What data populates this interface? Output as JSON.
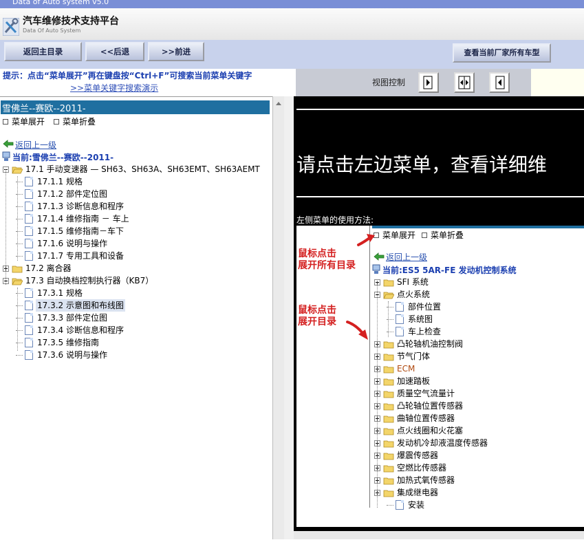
{
  "window": {
    "title": "Data of Auto system v5.0"
  },
  "header": {
    "title": "汽车维修技术支持平台",
    "subtitle": "Data Of Auto System"
  },
  "toolbar": {
    "home": "返回主目录",
    "back": "<<后退",
    "forward": ">>前进",
    "all_models": "查看当前厂家所有车型"
  },
  "tip": {
    "text": "提示：点击“菜单展开”再在键盘按“Ctrl+F”可搜索当前菜单关键字",
    "link": ">>菜单关键字搜索演示"
  },
  "view": {
    "label": "视图控制"
  },
  "left": {
    "car_title": "雪佛兰--赛欧--2011-",
    "expand": "菜单展开",
    "collapse": "菜单折叠",
    "back_link": "返回上一级",
    "current": "当前:雪佛兰--赛欧--2011-",
    "tree": [
      {
        "label": "17.1 手动变速器 — SH63、SH63A、SH63EMT、SH63AEMT",
        "kind": "folder-open"
      },
      {
        "label": "17.1.1 规格",
        "kind": "doc"
      },
      {
        "label": "17.1.2 部件定位图",
        "kind": "doc"
      },
      {
        "label": "17.1.3 诊断信息和程序",
        "kind": "doc"
      },
      {
        "label": "17.1.4 维修指南 － 车上",
        "kind": "doc"
      },
      {
        "label": "17.1.5 维修指南－车下",
        "kind": "doc"
      },
      {
        "label": "17.1.6 说明与操作",
        "kind": "doc"
      },
      {
        "label": "17.1.7 专用工具和设备",
        "kind": "doc"
      },
      {
        "label": "17.2 离合器",
        "kind": "folder-closed"
      },
      {
        "label": "17.3 自动换档控制执行器（KB7）",
        "kind": "folder-open"
      },
      {
        "label": "17.3.1 规格",
        "kind": "doc"
      },
      {
        "label": "17.3.2 示意图和布线图",
        "kind": "doc",
        "selected": true
      },
      {
        "label": "17.3.3 部件定位图",
        "kind": "doc"
      },
      {
        "label": "17.3.4 诊断信息和程序",
        "kind": "doc"
      },
      {
        "label": "17.3.5 维修指南",
        "kind": "doc"
      },
      {
        "label": "17.3.6 说明与操作",
        "kind": "doc"
      }
    ]
  },
  "right": {
    "prompt": "请点击左边菜单，查看详细维",
    "howto": "左侧菜单的使用方法:",
    "demo": {
      "expand": "菜单展开",
      "collapse": "菜单折叠",
      "back_link": "返回上一级",
      "current": "当前:ES5 5AR-FE 发动机控制系统",
      "note1": [
        "鼠标点击",
        "展开所有目录"
      ],
      "note2": [
        "鼠标点击",
        "展开目录"
      ],
      "tree": [
        {
          "label": "SFI 系统",
          "kind": "folder-closed"
        },
        {
          "label": "点火系统",
          "kind": "folder-open"
        },
        {
          "label": "部件位置",
          "kind": "doc"
        },
        {
          "label": "系统图",
          "kind": "doc"
        },
        {
          "label": "车上检查",
          "kind": "doc"
        },
        {
          "label": "凸轮轴机油控制阀",
          "kind": "folder-closed"
        },
        {
          "label": "节气门体",
          "kind": "folder-closed"
        },
        {
          "label": "ECM",
          "kind": "folder-closed",
          "color": "#b04a10"
        },
        {
          "label": "加速踏板",
          "kind": "folder-closed"
        },
        {
          "label": "质量空气流量计",
          "kind": "folder-closed"
        },
        {
          "label": "凸轮轴位置传感器",
          "kind": "folder-closed"
        },
        {
          "label": "曲轴位置传感器",
          "kind": "folder-closed"
        },
        {
          "label": "点火线圈和火花塞",
          "kind": "folder-closed"
        },
        {
          "label": "发动机冷却液温度传感器",
          "kind": "folder-closed"
        },
        {
          "label": "爆震传感器",
          "kind": "folder-closed"
        },
        {
          "label": "空燃比传感器",
          "kind": "folder-closed"
        },
        {
          "label": "加热式氧传感器",
          "kind": "folder-closed"
        },
        {
          "label": "集成继电器",
          "kind": "folder-closed"
        },
        {
          "label": "安装",
          "kind": "doc"
        }
      ]
    }
  },
  "colors": {
    "accent": "#1f6fa0",
    "tip": "#1b3fb0",
    "link": "#2a52b0",
    "annotation": "#d42020"
  }
}
